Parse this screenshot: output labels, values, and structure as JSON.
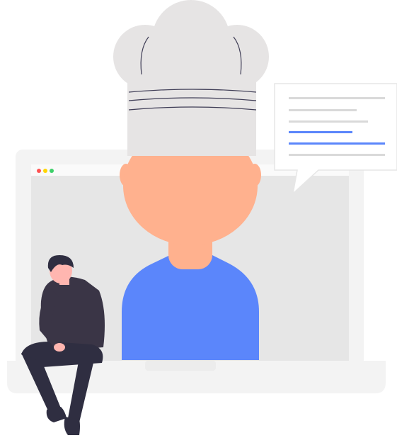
{
  "illustration": {
    "subject": "video-call-with-chef",
    "colors": {
      "background": "#ffffff",
      "laptop_frame": "#f2f2f2",
      "laptop_screen": "#e6e6e6",
      "laptop_base": "#f2f2f2",
      "traffic_red": "#ff5252",
      "traffic_yellow": "#ffd500",
      "traffic_green": "#3ecf6a",
      "skin": "#ffb18e",
      "shirt_blue": "#5b86fb",
      "chef_hat": "#e6e4e4",
      "hat_lines": "#3f3d56",
      "speech_bubble": "#ffffff",
      "bubble_line_gray": "#d9d9d9",
      "bubble_line_blue": "#5b86fb",
      "person_top": "#3a3546",
      "person_pants": "#2f2e41",
      "person_hair": "#2f2e41",
      "person_skin": "#ffb6b0"
    },
    "icons": [
      "laptop-icon",
      "chef-hat-icon",
      "speech-bubble-icon",
      "person-icon"
    ]
  }
}
